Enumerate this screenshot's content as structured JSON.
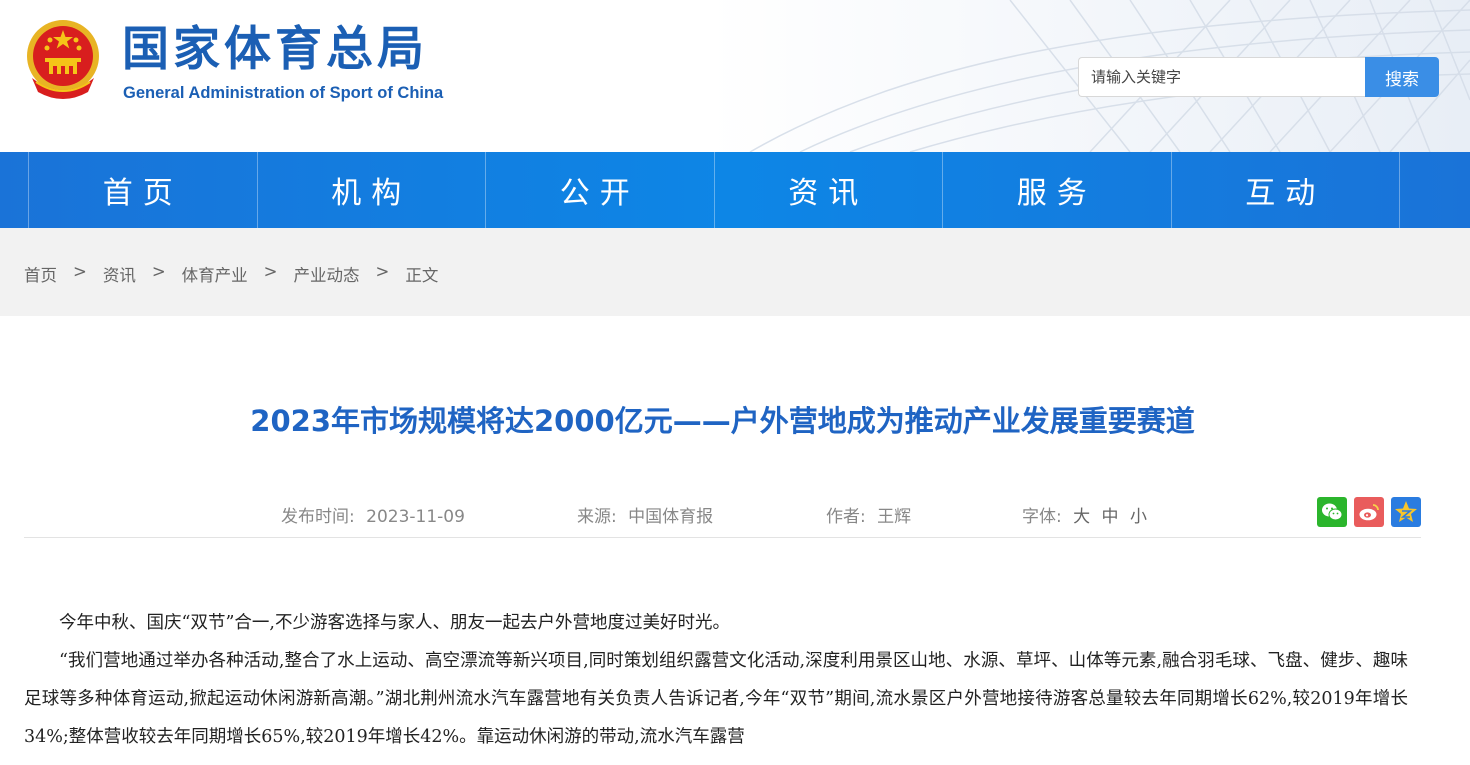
{
  "header": {
    "title_cn": "国家体育总局",
    "title_en": "General Administration of Sport of China",
    "search_placeholder": "请输入关键字",
    "search_button": "搜索"
  },
  "nav": {
    "items": [
      "首页",
      "机构",
      "公开",
      "资讯",
      "服务",
      "互动"
    ]
  },
  "breadcrumb": {
    "items": [
      "首页",
      "资讯",
      "体育产业",
      "产业动态",
      "正文"
    ],
    "separator": ">"
  },
  "article": {
    "title": "2023年市场规模将达2000亿元——户外营地成为推动产业发展重要赛道",
    "meta": {
      "publish_label": "发布时间:",
      "publish_date": "2023-11-09",
      "source_label": "来源:",
      "source": "中国体育报",
      "author_label": "作者:",
      "author": "王辉",
      "font_label": "字体:",
      "font_large": "大",
      "font_medium": "中",
      "font_small": "小"
    },
    "share": [
      "wechat-icon",
      "weibo-icon",
      "qzone-icon"
    ],
    "paragraphs": [
      "今年中秋、国庆“双节”合一,不少游客选择与家人、朋友一起去户外营地度过美好时光。",
      "“我们营地通过举办各种活动,整合了水上运动、高空漂流等新兴项目,同时策划组织露营文化活动,深度利用景区山地、水源、草坪、山体等元素,融合羽毛球、飞盘、健步、趣味足球等多种体育运动,掀起运动休闲游新高潮。”湖北荆州流水汽车露营地有关负责人告诉记者,今年“双节”期间,流水景区户外营地接待游客总量较去年同期增长62%,较2019年增长34%;整体营收较去年同期增长65%,较2019年增长42%。靠运动休闲游的带动,流水汽车露营"
    ]
  },
  "colors": {
    "brand": "#1b5fb4",
    "nav": "#0d86e6",
    "title": "#1f64c3",
    "search_button": "#3a8ee6"
  }
}
